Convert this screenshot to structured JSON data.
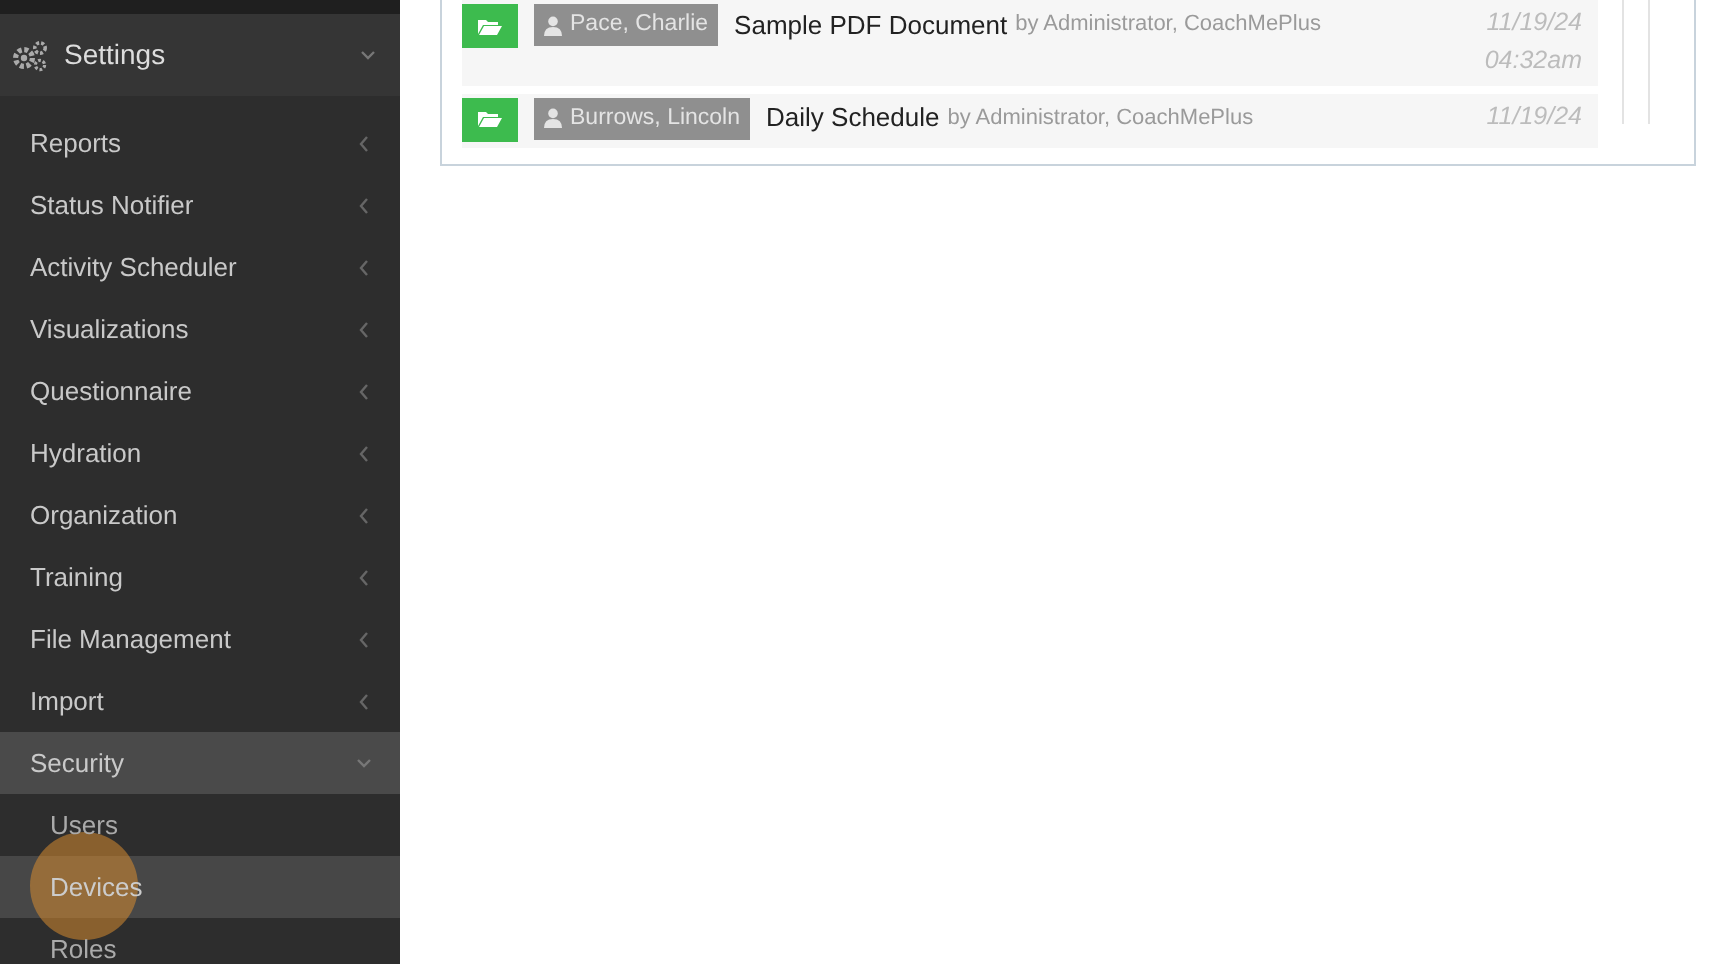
{
  "sidebar": {
    "header": {
      "label": "Settings",
      "expanded": true
    },
    "items": [
      {
        "label": "Reports",
        "expanded": false
      },
      {
        "label": "Status Notifier",
        "expanded": false
      },
      {
        "label": "Activity Scheduler",
        "expanded": false
      },
      {
        "label": "Visualizations",
        "expanded": false
      },
      {
        "label": "Questionnaire",
        "expanded": false
      },
      {
        "label": "Hydration",
        "expanded": false
      },
      {
        "label": "Organization",
        "expanded": false
      },
      {
        "label": "Training",
        "expanded": false
      },
      {
        "label": "File Management",
        "expanded": false
      },
      {
        "label": "Import",
        "expanded": false
      },
      {
        "label": "Security",
        "expanded": true,
        "children": [
          {
            "label": "Users",
            "selected": false
          },
          {
            "label": "Devices",
            "selected": true
          },
          {
            "label": "Roles",
            "selected": false
          }
        ]
      }
    ]
  },
  "documents": [
    {
      "user": "Pace, Charlie",
      "title": "Sample PDF Document",
      "by": "by Administrator, CoachMePlus",
      "date": "11/19/24",
      "time": "04:32am"
    },
    {
      "user": "Burrows, Lincoln",
      "title": "Daily Schedule",
      "by": "by Administrator, CoachMePlus",
      "date": "11/19/24"
    }
  ]
}
